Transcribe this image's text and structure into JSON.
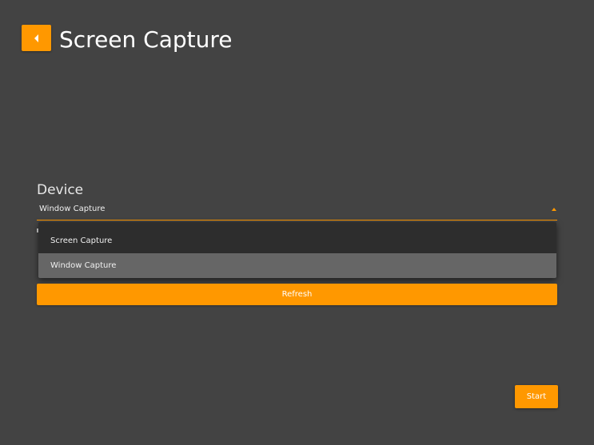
{
  "header": {
    "back_icon": "back-arrow-icon",
    "title": "Screen Capture"
  },
  "device": {
    "label": "Device",
    "selected_value": "Window Capture",
    "options": [
      {
        "label": "Screen Capture",
        "selected": false
      },
      {
        "label": "Window Capture",
        "selected": true
      }
    ]
  },
  "actions": {
    "refresh_label": "Refresh",
    "start_label": "Start"
  },
  "colors": {
    "accent": "#ff9800",
    "background": "#434343",
    "dropdown_background": "#2d2d2d",
    "selected_item": "#666666"
  }
}
